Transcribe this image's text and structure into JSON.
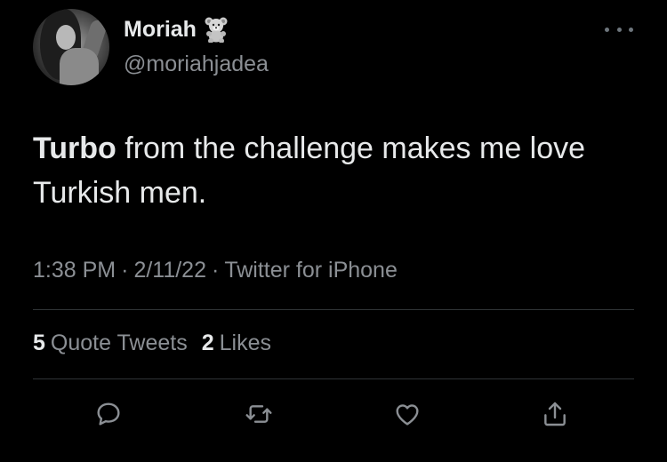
{
  "tweet": {
    "author": {
      "display_name": "Moriah",
      "emoji": "teddy-bear-icon",
      "handle": "@moriahjadea"
    },
    "text": {
      "bold": "Turbo",
      "rest": " from the challenge makes me love Turkish men."
    },
    "meta": {
      "time": "1:38 PM",
      "separator": "·",
      "date": "2/11/22",
      "source": "Twitter for iPhone"
    },
    "stats": {
      "quote_count": "5",
      "quote_label": "Quote Tweets",
      "like_count": "2",
      "like_label": "Likes"
    },
    "actions": [
      "reply-icon",
      "retweet-icon",
      "like-icon",
      "share-icon"
    ]
  },
  "colors": {
    "background": "#000000",
    "primary_text": "#e7e9ea",
    "secondary_text": "#8b8f94",
    "divider": "#2f3336"
  }
}
